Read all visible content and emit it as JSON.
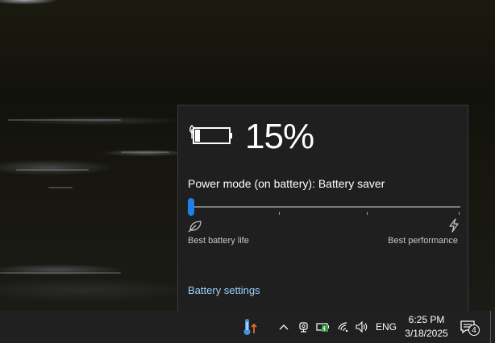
{
  "battery_flyout": {
    "percent": "15%",
    "battery_level": 0.15,
    "power_mode_label": "Power mode (on battery): Battery saver",
    "slider_value": 0,
    "slider_left_label": "Best battery life",
    "slider_right_label": "Best performance",
    "settings_link": "Battery settings",
    "accent_color": "#1f7fe6",
    "link_color": "#9fd0ff"
  },
  "taskbar": {
    "language": "ENG",
    "time": "6:25 PM",
    "date": "3/18/2025",
    "notification_count": "4",
    "tray_icons": [
      "thermometer-icon",
      "chevron-up-icon",
      "meet-now-icon",
      "battery-charging-icon",
      "wifi-icon",
      "volume-icon",
      "notification-icon"
    ]
  }
}
